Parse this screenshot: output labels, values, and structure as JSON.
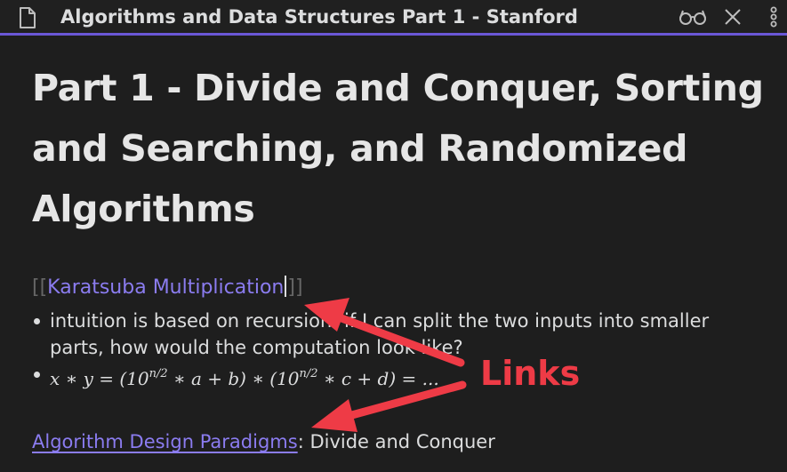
{
  "window": {
    "title": "Algorithms and Data Structures Part 1 - Stanford",
    "icons": [
      "document-icon",
      "reading-view-icon",
      "close-icon",
      "more-options-icon"
    ]
  },
  "note": {
    "heading": "Part 1 - Divide and Conquer, Sorting and Searching, and Randomized Algorithms",
    "wiki_link": {
      "open_brackets": "[[",
      "text": "Karatsuba Multiplication",
      "close_brackets": "]]"
    },
    "bullets": [
      {
        "text": "intuition is based on recursion: if I can split the two inputs into smaller parts, how would the computation look like?"
      }
    ],
    "formula": {
      "part1": "x ∗ y = (10",
      "exp1": "n/2",
      "part2": " ∗ a + b) ∗ (10",
      "exp2": "n/2",
      "part3": " ∗ c + d) =  ..."
    },
    "bottom_link": "Algorithm Design Paradigms",
    "bottom_rest": ": Divide and Conquer"
  },
  "annotation": {
    "label": "Links",
    "color": "#ee3b46"
  },
  "colors": {
    "accent": "#6a57d6",
    "link": "#8b7cf0",
    "background": "#1e1e1e",
    "text": "#dcddde"
  }
}
